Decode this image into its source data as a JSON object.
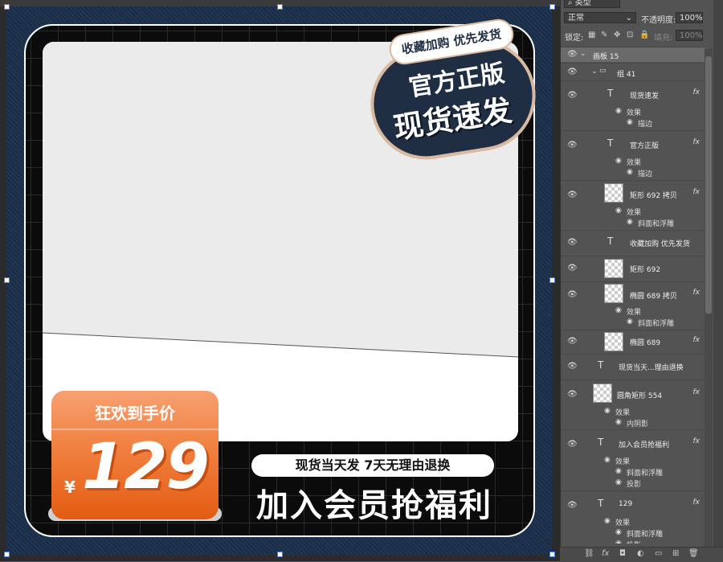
{
  "canvas": {
    "artboard_label": "画板 15",
    "stamp": {
      "tag": "收藏加购 优先发货",
      "line1": "官方正版",
      "line2": "现货速发"
    },
    "price": {
      "label": "狂欢到手价",
      "currency": "¥",
      "value": "129"
    },
    "slogan": "现货当天发  7天无理由退换",
    "member_title": "加入会员抢福利"
  },
  "panel": {
    "search_placeholder": "类型",
    "blend_mode": "正常",
    "opacity_label": "不透明度:",
    "opacity_value": "100%",
    "lock_label": "锁定:",
    "fill_label": "填充:",
    "fill_value": "100%",
    "layers": [
      {
        "name": "画板 15",
        "kind": "artboard"
      },
      {
        "name": "组 41",
        "kind": "group"
      },
      {
        "name": "现货速发",
        "kind": "text",
        "fx": "fx",
        "effects": [
          "效果",
          "描边"
        ]
      },
      {
        "name": "官方正版",
        "kind": "text",
        "fx": "fx",
        "effects": [
          "效果",
          "描边"
        ]
      },
      {
        "name": "矩形 692 拷贝",
        "kind": "shape",
        "fx": "fx",
        "effects": [
          "效果",
          "斜面和浮雕"
        ]
      },
      {
        "name": "收藏加购 优先发货",
        "kind": "text"
      },
      {
        "name": "矩形 692",
        "kind": "shape"
      },
      {
        "name": "椭圆 689 拷贝",
        "kind": "shape",
        "fx": "fx",
        "effects": [
          "效果",
          "斜面和浮雕"
        ]
      },
      {
        "name": "椭圆 689",
        "kind": "shape",
        "fx": "fx"
      },
      {
        "name": "现货当天...理由退换",
        "kind": "text"
      },
      {
        "name": "圆角矩形 554",
        "kind": "shape",
        "fx": "fx",
        "effects": [
          "效果",
          "内阴影"
        ]
      },
      {
        "name": "加入会员抢福利",
        "kind": "text",
        "fx": "fx",
        "effects": [
          "效果",
          "斜面和浮雕",
          "投影"
        ]
      },
      {
        "name": "129",
        "kind": "text",
        "fx": "fx",
        "effects": [
          "效果",
          "斜面和浮雕",
          "投影"
        ]
      }
    ],
    "bottom_icons": [
      "link-icon",
      "fx-icon",
      "mask-icon",
      "adjustment-icon",
      "folder-icon",
      "new-layer-icon",
      "trash-icon"
    ],
    "bottom_glyphs": [
      "⛓",
      "fx",
      "◘",
      "◐",
      "▭",
      "⊞",
      "🗑"
    ]
  },
  "colors": {
    "price_orange": "#f08040",
    "stamp_navy": "#1f2e42",
    "stamp_border": "#d9b9a0"
  }
}
